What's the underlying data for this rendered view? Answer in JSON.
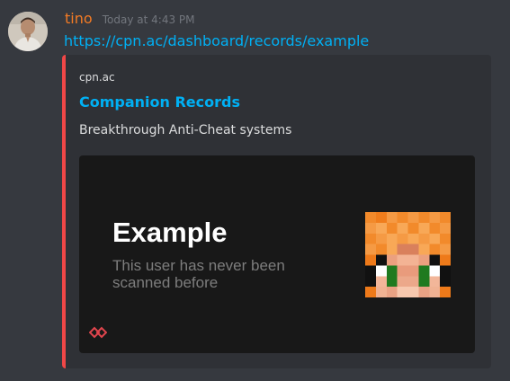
{
  "author": {
    "username": "tino",
    "timestamp": "Today at 4:43 PM",
    "username_color": "#f47b24",
    "avatar": "user-avatar-photo"
  },
  "message": {
    "link_text": "https://cpn.ac/dashboard/records/example"
  },
  "embed": {
    "accent_color": "#f04747",
    "provider": "cpn.ac",
    "title": "Companion Records",
    "description": "Breakthrough Anti-Cheat systems",
    "image": {
      "heading": "Example",
      "subtext": "This user has never been scanned before",
      "logo_icon": "companion-logo-icon",
      "face_icon": "minecraft-skin-face"
    }
  },
  "colors": {
    "background": "#36393f",
    "embed_background": "#2f3136",
    "link": "#00b0f4",
    "logo": "#e0454d"
  }
}
